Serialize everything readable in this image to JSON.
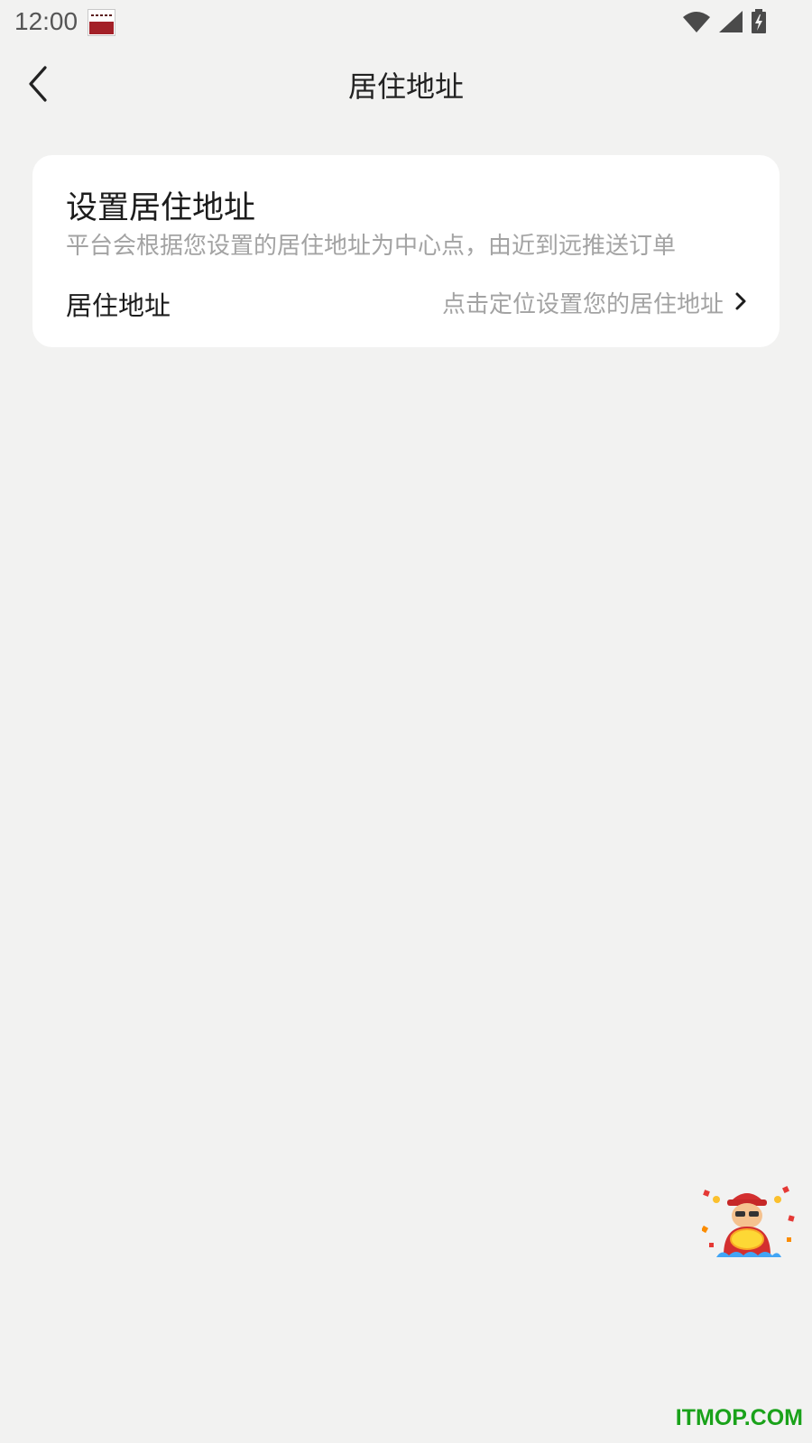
{
  "status_bar": {
    "time": "12:00",
    "icons": [
      "app-notification-icon",
      "wifi-icon",
      "cellular-signal-icon",
      "battery-charging-icon"
    ]
  },
  "header": {
    "title": "居住地址",
    "back_icon": "back-arrow-icon"
  },
  "card": {
    "title": "设置居住地址",
    "description": "平台会根据您设置的居住地址为中心点，由近到远推送订单",
    "address_row": {
      "label": "居住地址",
      "placeholder": "点击定位设置您的居住地址",
      "icon": "chevron-right-icon"
    }
  },
  "floating": {
    "icon": "mascot-icon"
  },
  "watermark": "ITMOP.COM",
  "colors": {
    "background": "#f2f2f1",
    "card": "#ffffff",
    "primary_text": "#1c1c1c",
    "secondary_text": "#a3a3a3",
    "watermark": "#1aa21a"
  }
}
